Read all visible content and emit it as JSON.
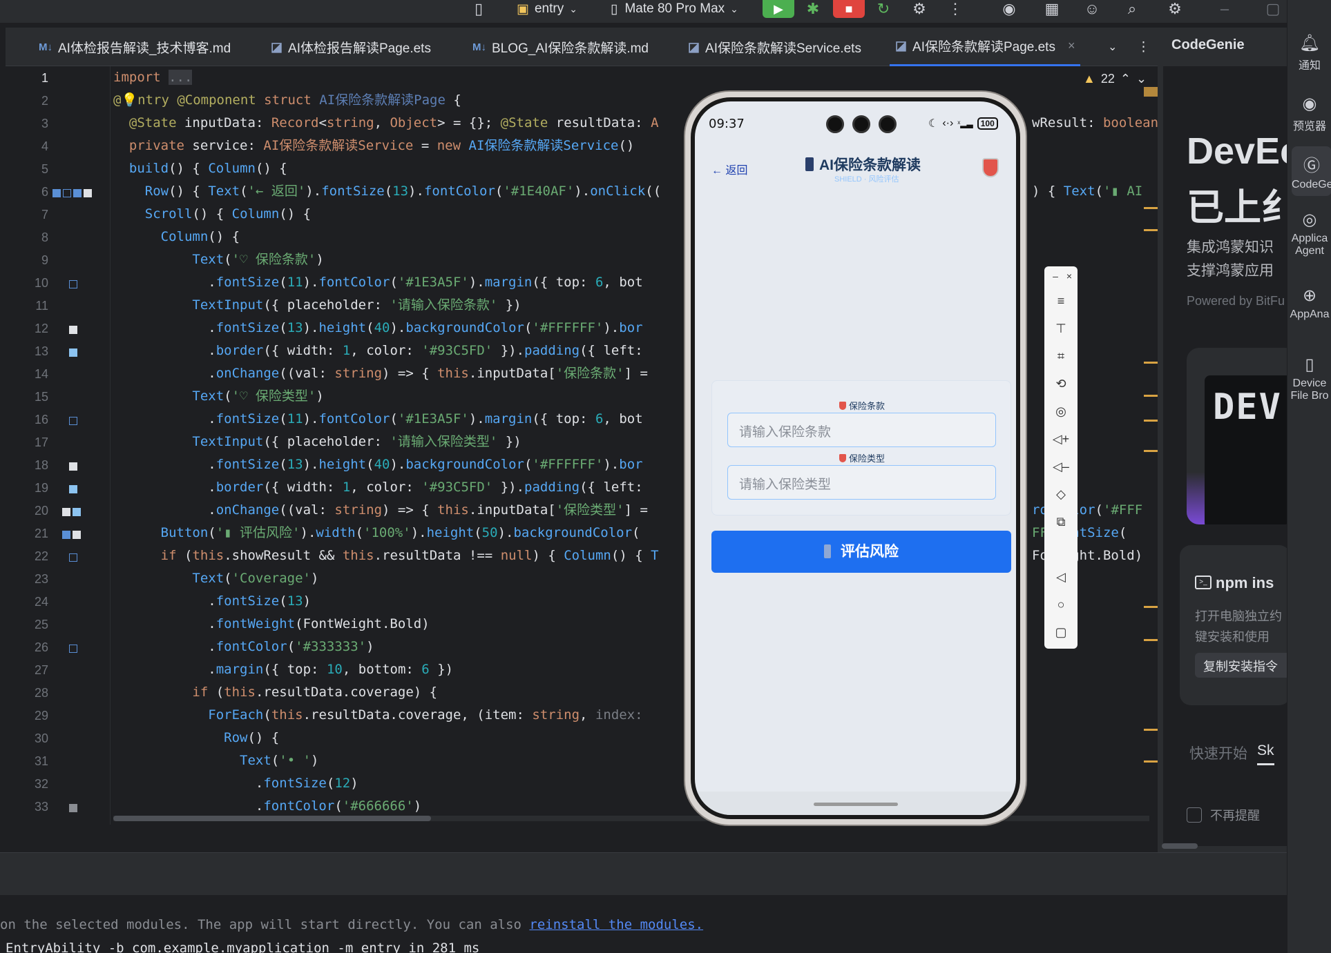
{
  "toolbar": {
    "module_label": "entry",
    "device_label": "Mate 80 Pro Max",
    "colors": {
      "run": "#4caf50",
      "stop": "#e0443e"
    }
  },
  "tabs": [
    {
      "label": "AI体检报告解读_技术博客.md",
      "kind": "md"
    },
    {
      "label": "AI体检报告解读Page.ets",
      "kind": "ets"
    },
    {
      "label": "BLOG_AI保险条款解读.md",
      "kind": "md"
    },
    {
      "label": "AI保险条款解读Service.ets",
      "kind": "ets"
    },
    {
      "label": "AI保险条款解读Page.ets",
      "kind": "ets",
      "active": true
    }
  ],
  "editor": {
    "warning_count": "22",
    "line_numbers": [
      "1",
      "2",
      "3",
      "4",
      "5",
      "6",
      "7",
      "8",
      "9",
      "10",
      "11",
      "12",
      "13",
      "14",
      "15",
      "16",
      "17",
      "18",
      "19",
      "20",
      "21",
      "22",
      "23",
      "24",
      "25",
      "26",
      "27",
      "28",
      "29",
      "30",
      "31",
      "32",
      "33"
    ]
  },
  "codegenie": {
    "panel_title": "CodeGenie",
    "headline_1": "DevEc",
    "headline_2": "已上纟",
    "sub_1": "集成鸿蒙知识",
    "sub_2": "支撑鸿蒙应用",
    "powered": "Powered by BitFu",
    "card_text": "DEV",
    "npm_title": "npm ins",
    "npm_desc_1": "打开电脑独立约",
    "npm_desc_2": "键安装和使用",
    "copy_button": "复制安装指令",
    "tab_quickstart": "快速开始",
    "tab_other": "Sk",
    "dont_remind": "不再提醒"
  },
  "right_strip": {
    "notify": "通知",
    "preview": "预览器",
    "codegenie": "CodeGe",
    "agent_1": "Applica",
    "agent_2": "Agent",
    "appana": "AppAna",
    "device_1": "Device",
    "device_2": "File Bro"
  },
  "console": {
    "line1_prefix": "  on the selected modules. The app will start directly. You can also ",
    "line1_link": "reinstall the modules.",
    "line2": "EntryAbility -b com.example.myapplication -m entry in 281 ms"
  },
  "phone": {
    "time": "09:37",
    "battery": "100",
    "back_label": "← 返回",
    "app_title": "AI保险条款解读",
    "app_subtitle": "SHIELD · 风险评估",
    "field1_label": "保险条款",
    "field1_placeholder": "请输入保险条款",
    "field2_label": "保险类型",
    "field2_placeholder": "请输入保险类型",
    "eval_button": "评估风险",
    "colors": {
      "button": "#1e6ff0",
      "label": "#1E3A5F",
      "border": "#93C5FD",
      "back": "#1E40AF"
    }
  }
}
